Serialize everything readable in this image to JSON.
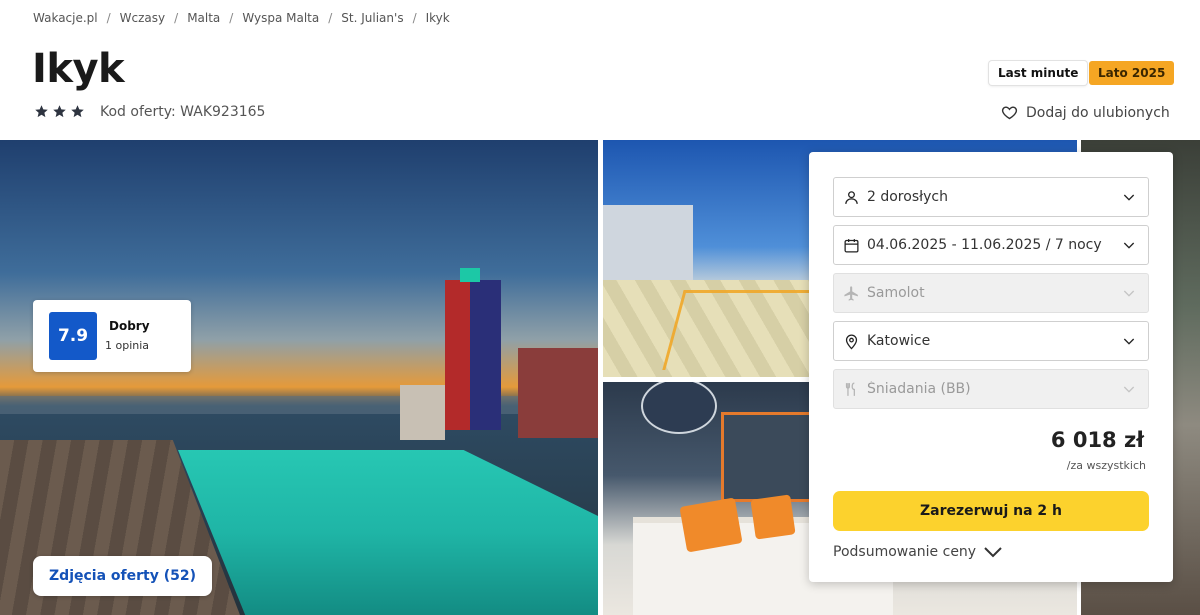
{
  "breadcrumb": {
    "items": [
      "Wakacje.pl",
      "Wczasy",
      "Malta",
      "Wyspa Malta",
      "St. Julian's",
      "Ikyk"
    ],
    "separator": "/"
  },
  "hotel": {
    "name": "Ikyk",
    "stars": 3,
    "offer_code": "Kod oferty: WAK923165"
  },
  "tags": {
    "last_minute": "Last minute",
    "season": "Lato 2025"
  },
  "favorite_label": "Dodaj do ulubionych",
  "rating": {
    "score": "7.9",
    "label": "Dobry",
    "count": "1 opinia"
  },
  "photos_button": "Zdjęcia oferty (52)",
  "booking": {
    "travelers": "2 dorosłych",
    "dates": "04.06.2025 - 11.06.2025 / 7 nocy",
    "transport": "Samolot",
    "departure": "Katowice",
    "board": "Śniadania (BB)",
    "price": "6 018 zł",
    "price_note": "/za wszystkich",
    "book_button": "Zarezerwuj na 2 h",
    "summary_link": "Podsumowanie ceny"
  },
  "colors": {
    "accent_blue": "#1359c9",
    "book_yellow": "#fcd22d",
    "season_orange": "#f5a623",
    "star": "#2e3440"
  },
  "icons": {
    "star": "star-icon",
    "heart": "heart-icon",
    "person": "person-icon",
    "calendar": "calendar-icon",
    "plane": "plane-icon",
    "location": "location-pin-icon",
    "food": "cutlery-icon",
    "chevron": "chevron-down-icon"
  }
}
